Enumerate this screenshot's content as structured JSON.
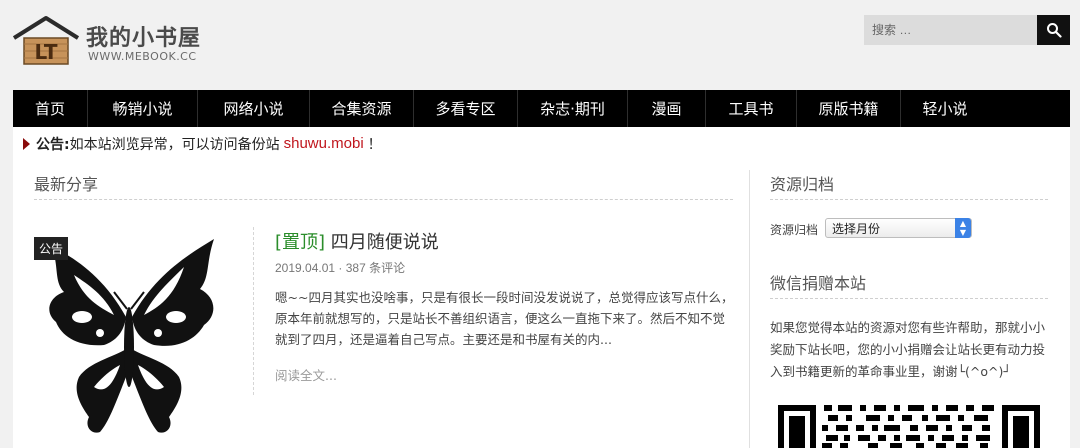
{
  "header": {
    "logo_badge": "LT",
    "logo_title": "我的小书屋",
    "logo_url": "WWW.MEBOOK.CC",
    "search_placeholder": "搜索 …"
  },
  "nav": {
    "items": [
      {
        "label": "首页"
      },
      {
        "label": "畅销小说"
      },
      {
        "label": "网络小说"
      },
      {
        "label": "合集资源"
      },
      {
        "label": "多看专区"
      },
      {
        "label": "杂志·期刊"
      },
      {
        "label": "漫画"
      },
      {
        "label": "工具书"
      },
      {
        "label": "原版书籍"
      },
      {
        "label": "轻小说"
      }
    ]
  },
  "notice": {
    "label": "公告:",
    "text": "如本站浏览异常，可以访问备份站",
    "link": "shuwu.mobi",
    "end": "！"
  },
  "main": {
    "section_title": "最新分享",
    "post": {
      "badge": "公告",
      "tag": "[置顶]",
      "title": "四月随便说说",
      "meta": "2019.04.01 · 387 条评论",
      "excerpt": "嗯~~四月其实也没啥事，只是有很长一段时间没发说说了，总觉得应该写点什么，原本年前就想写的，只是站长不善组织语言，便这么一直拖下来了。然后不知不觉就到了四月，还是逼着自己写点。主要还是和书屋有关的内...",
      "read_more": "阅读全文..."
    }
  },
  "sidebar": {
    "archive_title": "资源归档",
    "archive_label": "资源归档",
    "archive_select": "选择月份",
    "donate_title": "微信捐赠本站",
    "donate_text": "如果您觉得本站的资源对您有些许帮助，那就小小奖励下站长吧，您的小小捐赠会让站长更有动力投入到书籍更新的革命事业里，谢谢└(^o^)┘"
  },
  "colors": {
    "nav_bg": "#000000",
    "tag_green": "#2a8d2a",
    "link_red": "#c0161d",
    "select_blue": "#3b82e6"
  }
}
